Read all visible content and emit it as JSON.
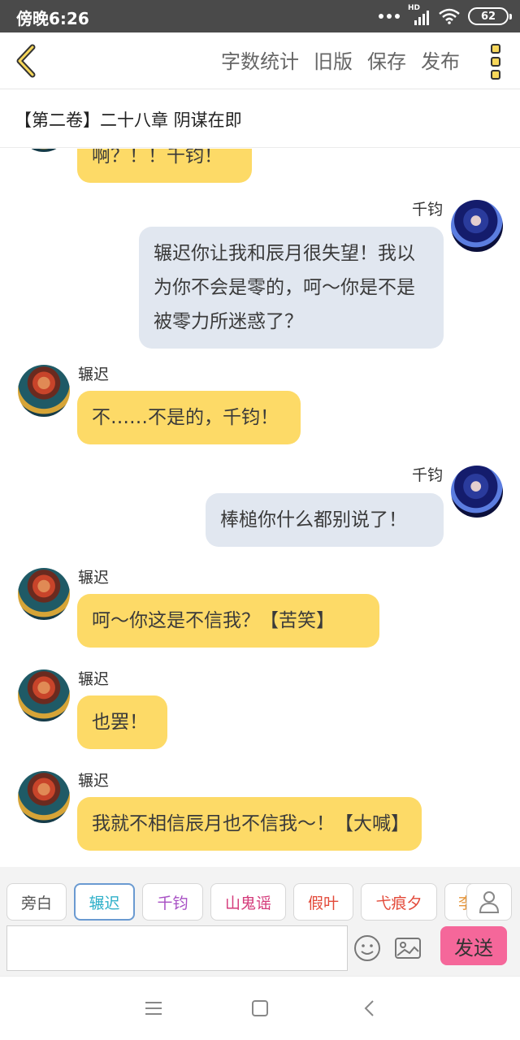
{
  "status_bar": {
    "time": "傍晚6:26",
    "network_label": "HD",
    "battery": "62"
  },
  "toolbar": {
    "word_count": "字数统计",
    "old_version": "旧版",
    "save": "保存",
    "publish": "发布"
  },
  "chapter_title": "【第二卷】二十八章 阴谋在即",
  "messages": [
    {
      "speaker": "",
      "text": "啊？！！千钧！",
      "side": "left"
    },
    {
      "speaker": "千钧",
      "text": "辗迟你让我和辰月很失望！我以为你不会是零的，呵～你是不是被零力所迷惑了？",
      "side": "right"
    },
    {
      "speaker": "辗迟",
      "text": "不……不是的，千钧！",
      "side": "left"
    },
    {
      "speaker": "千钧",
      "text": "棒槌你什么都别说了！",
      "side": "right"
    },
    {
      "speaker": "辗迟",
      "text": "呵～你这是不信我？【苦笑】",
      "side": "left"
    },
    {
      "speaker": "辗迟",
      "text": "也罢！",
      "side": "left"
    },
    {
      "speaker": "辗迟",
      "text": "我就不相信辰月也不信我～！【大喊】",
      "side": "left"
    }
  ],
  "characters": [
    {
      "label": "旁白",
      "color": "#555555",
      "active": false
    },
    {
      "label": "辗迟",
      "color": "#2fb0c9",
      "active": true
    },
    {
      "label": "千钧",
      "color": "#a74fc4",
      "active": false
    },
    {
      "label": "山鬼谣",
      "color": "#d43a7a",
      "active": false
    },
    {
      "label": "假叶",
      "color": "#e34a3a",
      "active": false
    },
    {
      "label": "弋痕夕",
      "color": "#e34a3a",
      "active": false
    },
    {
      "label": "李",
      "color": "#e5953a",
      "active": false
    }
  ],
  "input": {
    "placeholder": "",
    "send_label": "发送"
  },
  "icons": {
    "back": "chevron-left-icon",
    "more": "more-vertical-icon",
    "emoji": "emoji-icon",
    "image": "image-icon",
    "person": "person-icon"
  },
  "colors": {
    "left_bubble": "#fdda67",
    "right_bubble": "#e1e7f0",
    "send_button": "#f5679a",
    "status_bar": "#4a4a4a"
  }
}
